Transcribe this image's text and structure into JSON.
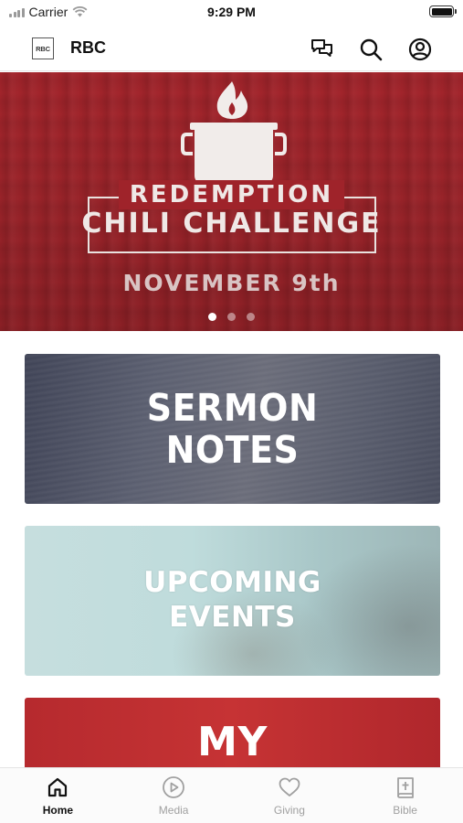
{
  "status_bar": {
    "carrier": "Carrier",
    "time": "9:29 PM"
  },
  "header": {
    "logo_text": "RBC",
    "title": "RBC",
    "icons": [
      "chat-icon",
      "search-icon",
      "account-icon"
    ]
  },
  "banner": {
    "line1": "REDEMPTION",
    "line2": "CHILI CHALLENGE",
    "line3": "NOVEMBER 9th",
    "slide_count": 3,
    "active_slide": 1,
    "background_color": "#9f232a"
  },
  "cards": [
    {
      "line1": "SERMON",
      "line2": "NOTES"
    },
    {
      "line1": "UPCOMING",
      "line2": "EVENTS"
    },
    {
      "line1": "MY"
    }
  ],
  "tabs": [
    {
      "label": "Home",
      "icon": "home-icon",
      "active": true
    },
    {
      "label": "Media",
      "icon": "play-circle-icon",
      "active": false
    },
    {
      "label": "Giving",
      "icon": "heart-icon",
      "active": false
    },
    {
      "label": "Bible",
      "icon": "bible-icon",
      "active": false
    }
  ]
}
